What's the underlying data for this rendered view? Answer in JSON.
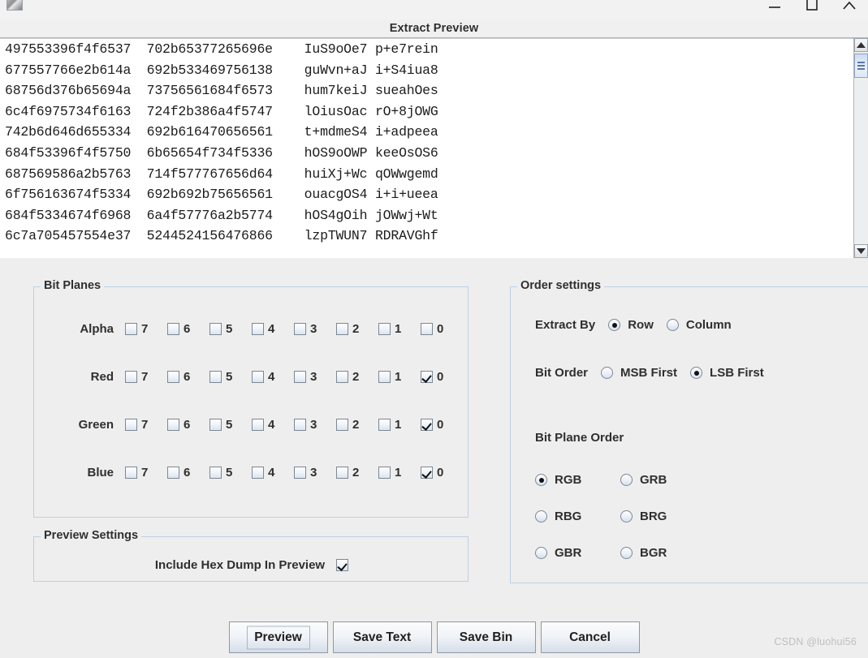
{
  "window": {
    "app_icon": "image-file-icon",
    "controls": [
      {
        "name": "minimize-button",
        "glyph": "minimize-icon"
      },
      {
        "name": "maximize-button",
        "glyph": "maximize-icon"
      },
      {
        "name": "close-button",
        "glyph": "close-icon"
      }
    ]
  },
  "header": {
    "title": "Extract Preview"
  },
  "preview": {
    "lines": [
      "497553396f4f6537  702b65377265696e    IuS9oOe7 p+e7rein",
      "677557766e2b614a  692b533469756138    guWvn+aJ i+S4iua8",
      "68756d376b65694a  73756561684f6573    hum7keiJ sueahOes",
      "6c4f6975734f6163  724f2b386a4f5747    lOiusOac rO+8jOWG",
      "742b6d646d655334  692b616470656561    t+mdmeS4 i+adpeea",
      "684f53396f4f5750  6b65654f734f5336    hOS9oOWP keeOsOS6",
      "687569586a2b5763  714f577767656d64    huiXj+Wc qOWwgemd",
      "6f756163674f5334  692b692b75656561    ouacgOS4 i+i+ueea",
      "684f5334674f6968  6a4f57776a2b5774    hOS4gOih jOWwj+Wt",
      "6c7a705457554e37  5244524156476866    lzpTWUN7 RDRAVGhf"
    ],
    "scrollbar": {
      "up_arrow": "scroll-up-icon",
      "down_arrow": "scroll-down-icon"
    }
  },
  "bit_planes": {
    "legend": "Bit Planes",
    "bits": [
      "7",
      "6",
      "5",
      "4",
      "3",
      "2",
      "1",
      "0"
    ],
    "rows": [
      {
        "channel": "Alpha",
        "checked": [
          false,
          false,
          false,
          false,
          false,
          false,
          false,
          false
        ]
      },
      {
        "channel": "Red",
        "checked": [
          false,
          false,
          false,
          false,
          false,
          false,
          false,
          true
        ]
      },
      {
        "channel": "Green",
        "checked": [
          false,
          false,
          false,
          false,
          false,
          false,
          false,
          true
        ]
      },
      {
        "channel": "Blue",
        "checked": [
          false,
          false,
          false,
          false,
          false,
          false,
          false,
          true
        ]
      }
    ]
  },
  "preview_settings": {
    "legend": "Preview Settings",
    "include_hex_dump_label": "Include Hex Dump In Preview",
    "include_hex_dump_checked": true
  },
  "order_settings": {
    "legend": "Order settings",
    "extract_by": {
      "label": "Extract By",
      "options": [
        "Row",
        "Column"
      ],
      "selected": "Row"
    },
    "bit_order": {
      "label": "Bit Order",
      "options": [
        "MSB First",
        "LSB First"
      ],
      "selected": "LSB First"
    },
    "bit_plane_order": {
      "label": "Bit Plane Order",
      "options": [
        "RGB",
        "GRB",
        "RBG",
        "BRG",
        "GBR",
        "BGR"
      ],
      "selected": "RGB"
    }
  },
  "buttons": [
    {
      "name": "preview-button",
      "label": "Preview",
      "focused": true
    },
    {
      "name": "save-text-button",
      "label": "Save Text",
      "focused": false
    },
    {
      "name": "save-bin-button",
      "label": "Save Bin",
      "focused": false
    },
    {
      "name": "cancel-button",
      "label": "Cancel",
      "focused": false
    }
  ],
  "watermark": {
    "text": "CSDN @luohui56"
  },
  "colors": {
    "window_background": "#eeeeee",
    "panel_border": "#bcd0e4",
    "text_area_background": "#ffffff",
    "scroll_thumb": "#cfdcee"
  }
}
